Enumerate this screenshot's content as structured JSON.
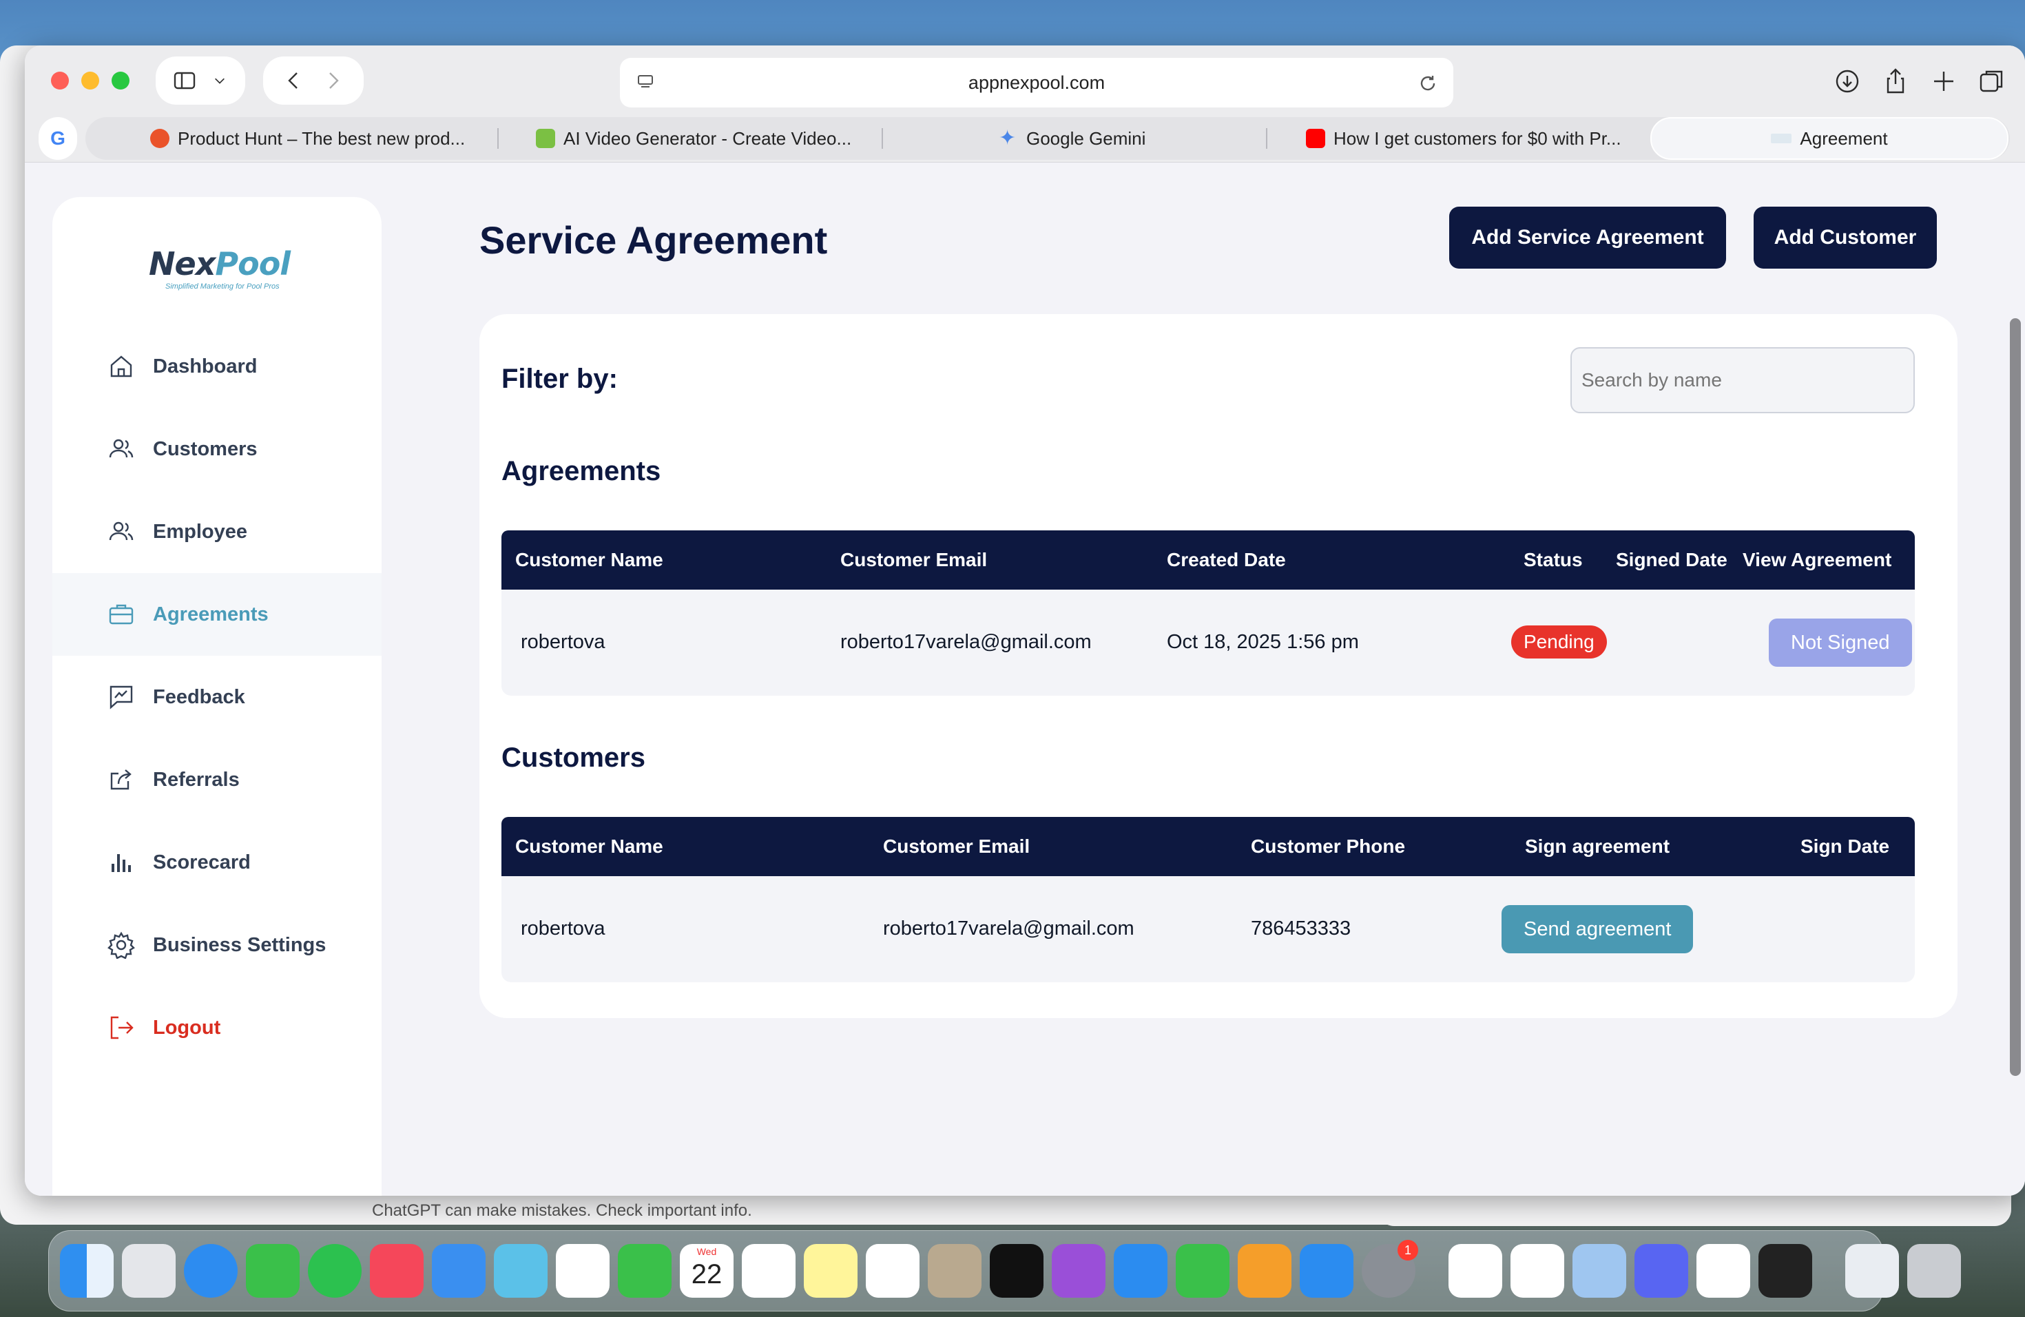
{
  "browser": {
    "url": "appnexpool.com",
    "tabs": [
      {
        "label": "Product Hunt – The best new prod...",
        "color": "#ea532a"
      },
      {
        "label": "AI Video Generator - Create Video...",
        "color": "#7bc043"
      },
      {
        "label": "Google Gemini",
        "color": "#4a86e8"
      },
      {
        "label": "How I get customers for $0 with Pr...",
        "color": "#ff0000"
      },
      {
        "label": "Agreement",
        "color": "#4aa0c0"
      }
    ],
    "google_label": "G"
  },
  "sidebar": {
    "logo_a": "Nex",
    "logo_b": "Pool",
    "logo_sub": "Simplified Marketing for Pool Pros",
    "items": [
      {
        "label": "Dashboard",
        "icon": "home-icon"
      },
      {
        "label": "Customers",
        "icon": "users-icon"
      },
      {
        "label": "Employee",
        "icon": "users-icon"
      },
      {
        "label": "Agreements",
        "icon": "briefcase-icon"
      },
      {
        "label": "Feedback",
        "icon": "feedback-icon"
      },
      {
        "label": "Referrals",
        "icon": "share-icon"
      },
      {
        "label": "Scorecard",
        "icon": "bar-chart-icon"
      },
      {
        "label": "Business Settings",
        "icon": "gear-icon"
      },
      {
        "label": "Logout",
        "icon": "logout-icon"
      }
    ]
  },
  "main": {
    "title": "Service Agreement",
    "add_agreement": "Add Service Agreement",
    "add_customer": "Add Customer",
    "filter_label": "Filter by:",
    "search_placeholder": "Search by name",
    "agreements": {
      "heading": "Agreements",
      "columns": [
        "Customer Name",
        "Customer Email",
        "Created Date",
        "Status",
        "Signed Date",
        "View Agreement"
      ],
      "row": {
        "name": "robertova",
        "email": "roberto17varela@gmail.com",
        "created": "Oct 18, 2025 1:56 pm",
        "status": "Pending",
        "signed": "",
        "action": "Not Signed"
      }
    },
    "customers": {
      "heading": "Customers",
      "columns": [
        "Customer Name",
        "Customer Email",
        "Customer Phone",
        "Sign agreement",
        "Sign Date"
      ],
      "row": {
        "name": "robertova",
        "email": "roberto17varela@gmail.com",
        "phone": "786453333",
        "action": "Send agreement",
        "date": ""
      }
    }
  },
  "background": {
    "chat_note": "ChatGPT can make mistakes. Check important info."
  },
  "dock": {
    "calendar_month": "Wed",
    "calendar_day": "22",
    "badge": "1"
  }
}
